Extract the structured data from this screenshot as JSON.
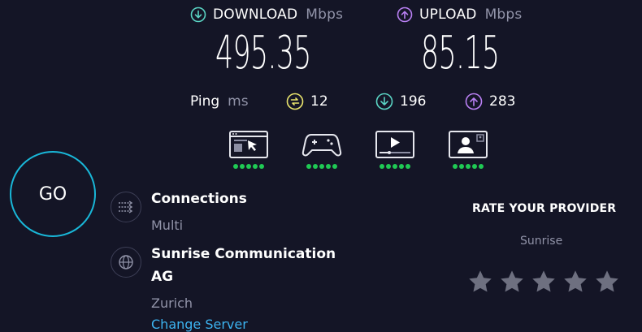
{
  "download": {
    "label": "DOWNLOAD",
    "unit": "Mbps",
    "value": "495.35",
    "icon": "arrow-down-circle-icon",
    "color": "#5ad3c3"
  },
  "upload": {
    "label": "UPLOAD",
    "unit": "Mbps",
    "value": "85.15",
    "icon": "arrow-up-circle-icon",
    "color": "#b87ff2"
  },
  "ping": {
    "label": "Ping",
    "unit": "ms",
    "idle": {
      "value": "12",
      "icon": "ping-idle-icon",
      "color": "#e8e36c"
    },
    "download": {
      "value": "196",
      "icon": "arrow-down-circle-icon",
      "color": "#5ad3c3"
    },
    "upload": {
      "value": "283",
      "icon": "arrow-up-circle-icon",
      "color": "#b87ff2"
    }
  },
  "activities": [
    {
      "name": "web-browsing-icon",
      "rating": 5
    },
    {
      "name": "gaming-icon",
      "rating": 5
    },
    {
      "name": "video-streaming-icon",
      "rating": 5
    },
    {
      "name": "video-chat-icon",
      "rating": 5
    }
  ],
  "go_button": {
    "label": "GO",
    "color": "#19b7d8"
  },
  "connections": {
    "title": "Connections",
    "value": "Multi",
    "icon": "connections-icon"
  },
  "server": {
    "title_line1": "Sunrise Communication",
    "title_line2": "AG",
    "location": "Zurich",
    "change_label": "Change Server",
    "icon": "globe-icon"
  },
  "rating": {
    "title": "RATE YOUR PROVIDER",
    "provider": "Sunrise",
    "stars": 5,
    "star_color": "#6e7080"
  },
  "colors": {
    "background": "#141526",
    "link": "#3cb3f0",
    "activity_good": "#1fca54"
  }
}
